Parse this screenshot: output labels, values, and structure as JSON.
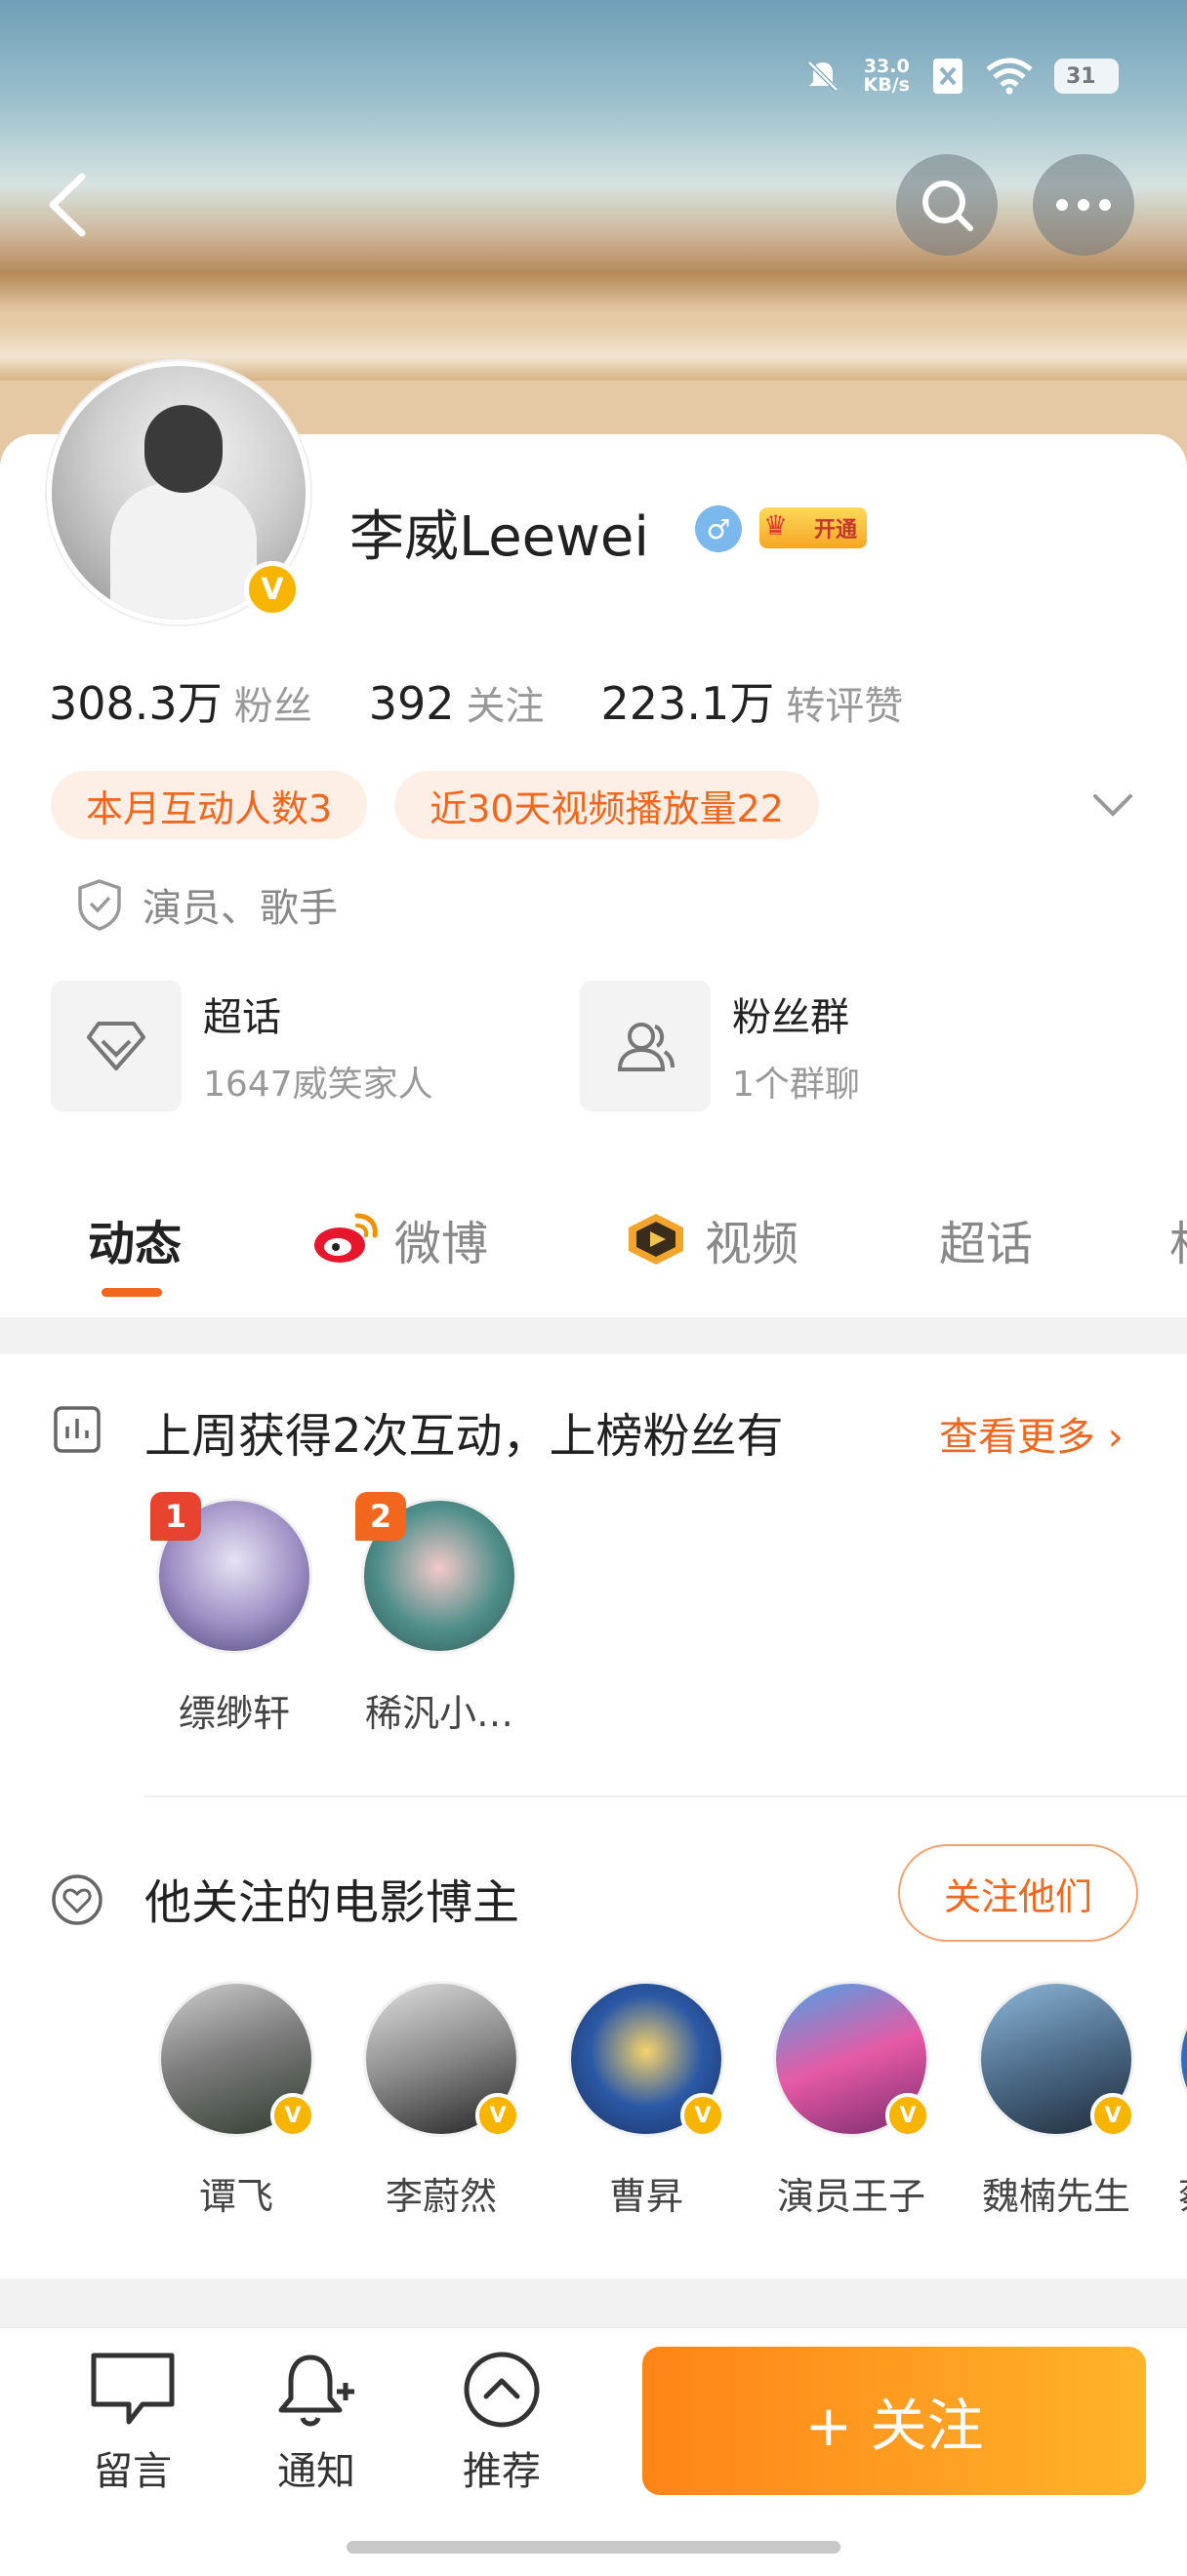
{
  "status_bar": {
    "net_speed": "33.0",
    "net_unit": "KB/s",
    "battery": "31"
  },
  "profile": {
    "name": "李威Leewei",
    "gender_symbol": "♂",
    "vip_label": "开通",
    "stats": [
      {
        "value": "308.3万",
        "label": "粉丝"
      },
      {
        "value": "392",
        "label": "关注"
      },
      {
        "value": "223.1万",
        "label": "转评赞"
      }
    ],
    "chips": [
      "本月互动人数3",
      "近30天视频播放量22"
    ],
    "occupation": "演员、歌手",
    "entries": [
      {
        "title": "超话",
        "subtitle": "1647威笑家人"
      },
      {
        "title": "粉丝群",
        "subtitle": "1个群聊"
      }
    ]
  },
  "tabs": [
    "动态",
    "微博",
    "视频",
    "超话",
    "相"
  ],
  "fans_section": {
    "title": "上周获得2次互动，上榜粉丝有",
    "more": "查看更多",
    "fans": [
      {
        "rank": "1",
        "name": "缥缈轩",
        "rank_color": "#e8432f"
      },
      {
        "rank": "2",
        "name": "稀汎小…",
        "rank_color": "#f2671d"
      }
    ]
  },
  "bloggers_section": {
    "title": "他关注的电影博主",
    "button": "关注他们",
    "verified_mark": "V",
    "bloggers": [
      {
        "name": "谭飞"
      },
      {
        "name": "李蔚然"
      },
      {
        "name": "曹昇"
      },
      {
        "name": "演员王子"
      },
      {
        "name": "魏楠先生"
      },
      {
        "name": "蔡"
      }
    ]
  },
  "bottom_bar": {
    "message": "留言",
    "notify": "通知",
    "recommend": "推荐",
    "follow": "+ 关注"
  },
  "colors": {
    "accent": "#f2671d",
    "verified": "#f7b500"
  }
}
